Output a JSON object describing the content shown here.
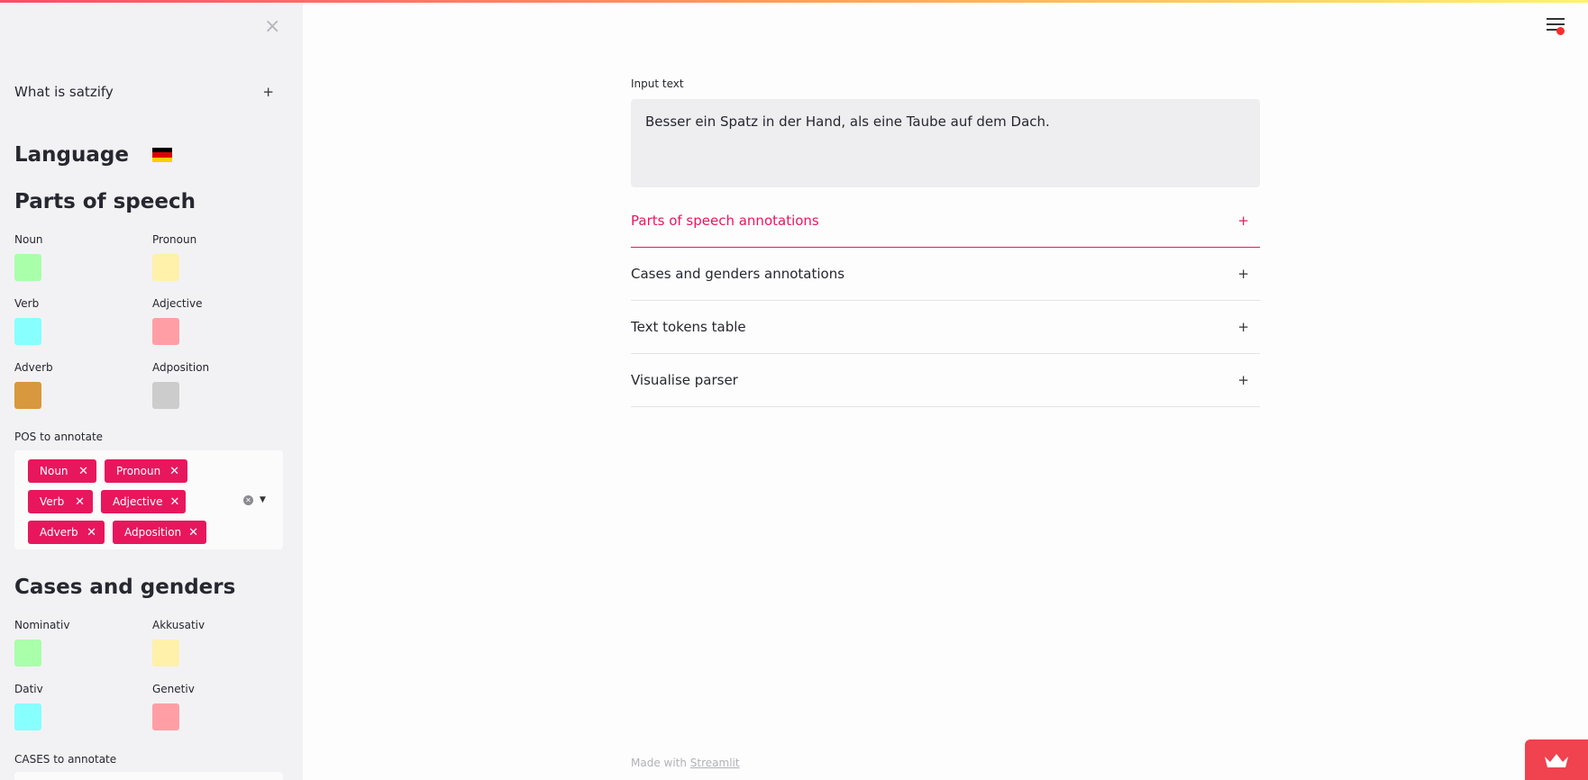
{
  "sidebar": {
    "close_label": "×",
    "what_is": "What is satzify",
    "what_is_toggle": "+",
    "language_heading": "Language",
    "pos_heading": "Parts of speech",
    "pos_swatches": [
      {
        "label": "Noun",
        "color": "#aaffaa"
      },
      {
        "label": "Pronoun",
        "color": "#fff0aa"
      },
      {
        "label": "Verb",
        "color": "#8ef"
      },
      {
        "label": "Adjective",
        "color": "#fea"
      },
      {
        "label": "Adverb",
        "color": "#d8983e"
      },
      {
        "label": "Adposition",
        "color": "#cccccc"
      }
    ],
    "pos_field_label": "POS to annotate",
    "pos_tags": [
      "Noun",
      "Pronoun",
      "Verb",
      "Adjective",
      "Adverb",
      "Adposition"
    ],
    "tag_remove": "✕",
    "cases_heading": "Cases and genders",
    "case_swatches": [
      {
        "label": "Nominativ",
        "color": "#aaffaa"
      },
      {
        "label": "Akkusativ",
        "color": "#fff0aa"
      },
      {
        "label": "Dativ",
        "color": "#88ffff"
      },
      {
        "label": "Genetiv",
        "color": "#ff9fa5"
      }
    ],
    "cases_field_label": "CASES to annotate"
  },
  "main": {
    "input_label": "Input text",
    "input_value": "Besser ein Spatz in der Hand, als eine Taube auf dem Dach.",
    "expanders": [
      {
        "label": "Parts of speech annotations",
        "toggle": "+",
        "active": true
      },
      {
        "label": "Cases and genders annotations",
        "toggle": "+",
        "active": false
      },
      {
        "label": "Text tokens table",
        "toggle": "+",
        "active": false
      },
      {
        "label": "Visualise parser",
        "toggle": "+",
        "active": false
      }
    ],
    "footer_prefix": "Made with ",
    "footer_link": "Streamlit"
  },
  "colors": {
    "accent": "#e8175d",
    "sidebar_bg": "#f2f2f4",
    "flag_black": "#000000",
    "flag_red": "#dd0000",
    "flag_gold": "#ffce00"
  },
  "icons": {
    "menu": "hamburger-menu-icon",
    "close": "close-icon",
    "flag": "german-flag-icon",
    "crown": "streamlit-crown-icon"
  }
}
